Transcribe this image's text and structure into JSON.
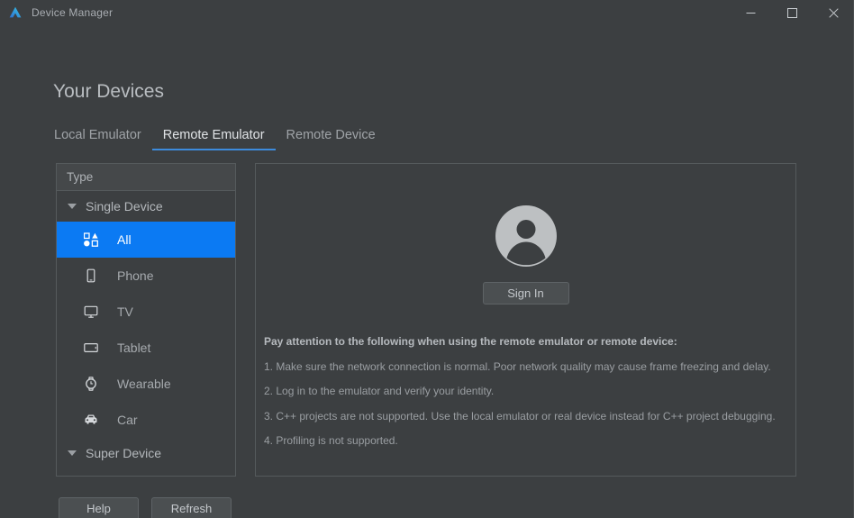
{
  "window": {
    "title": "Device Manager",
    "logo_icon": "deveco-logo-icon",
    "controls": [
      {
        "name": "minimize",
        "glyph": "minimize-icon"
      },
      {
        "name": "maximize",
        "glyph": "maximize-icon"
      },
      {
        "name": "close",
        "glyph": "close-icon"
      }
    ]
  },
  "page": {
    "title": "Your Devices"
  },
  "tabs": [
    {
      "label": "Local Emulator",
      "active": false
    },
    {
      "label": "Remote Emulator",
      "active": true
    },
    {
      "label": "Remote Device",
      "active": false
    }
  ],
  "device_list": {
    "header": "Type",
    "groups": [
      {
        "label": "Single Device",
        "expanded": true,
        "items": [
          {
            "label": "All",
            "icon": "all-devices-icon",
            "selected": true
          },
          {
            "label": "Phone",
            "icon": "phone-icon",
            "selected": false
          },
          {
            "label": "TV",
            "icon": "tv-icon",
            "selected": false
          },
          {
            "label": "Tablet",
            "icon": "tablet-icon",
            "selected": false
          },
          {
            "label": "Wearable",
            "icon": "wearable-icon",
            "selected": false
          },
          {
            "label": "Car",
            "icon": "car-icon",
            "selected": false
          }
        ]
      },
      {
        "label": "Super Device",
        "expanded": true,
        "items": []
      }
    ]
  },
  "content": {
    "avatar_icon": "user-avatar-icon",
    "sign_in_label": "Sign In",
    "notes_title": "Pay attention to the following when using the remote emulator or remote device:",
    "notes": [
      "1. Make sure the network connection is normal. Poor network quality may cause frame freezing and delay.",
      "2. Log in to the emulator and verify your identity.",
      "3. C++ projects are not supported. Use the local emulator or real device instead for C++ project debugging.",
      "4. Profiling is not supported."
    ]
  },
  "footer": {
    "help_label": "Help",
    "refresh_label": "Refresh"
  },
  "colors": {
    "background": "#3c3f41",
    "accent": "#0b7af3",
    "tab_underline": "#3d8bdc",
    "border": "#555a5c",
    "text": "#a9adb2"
  }
}
